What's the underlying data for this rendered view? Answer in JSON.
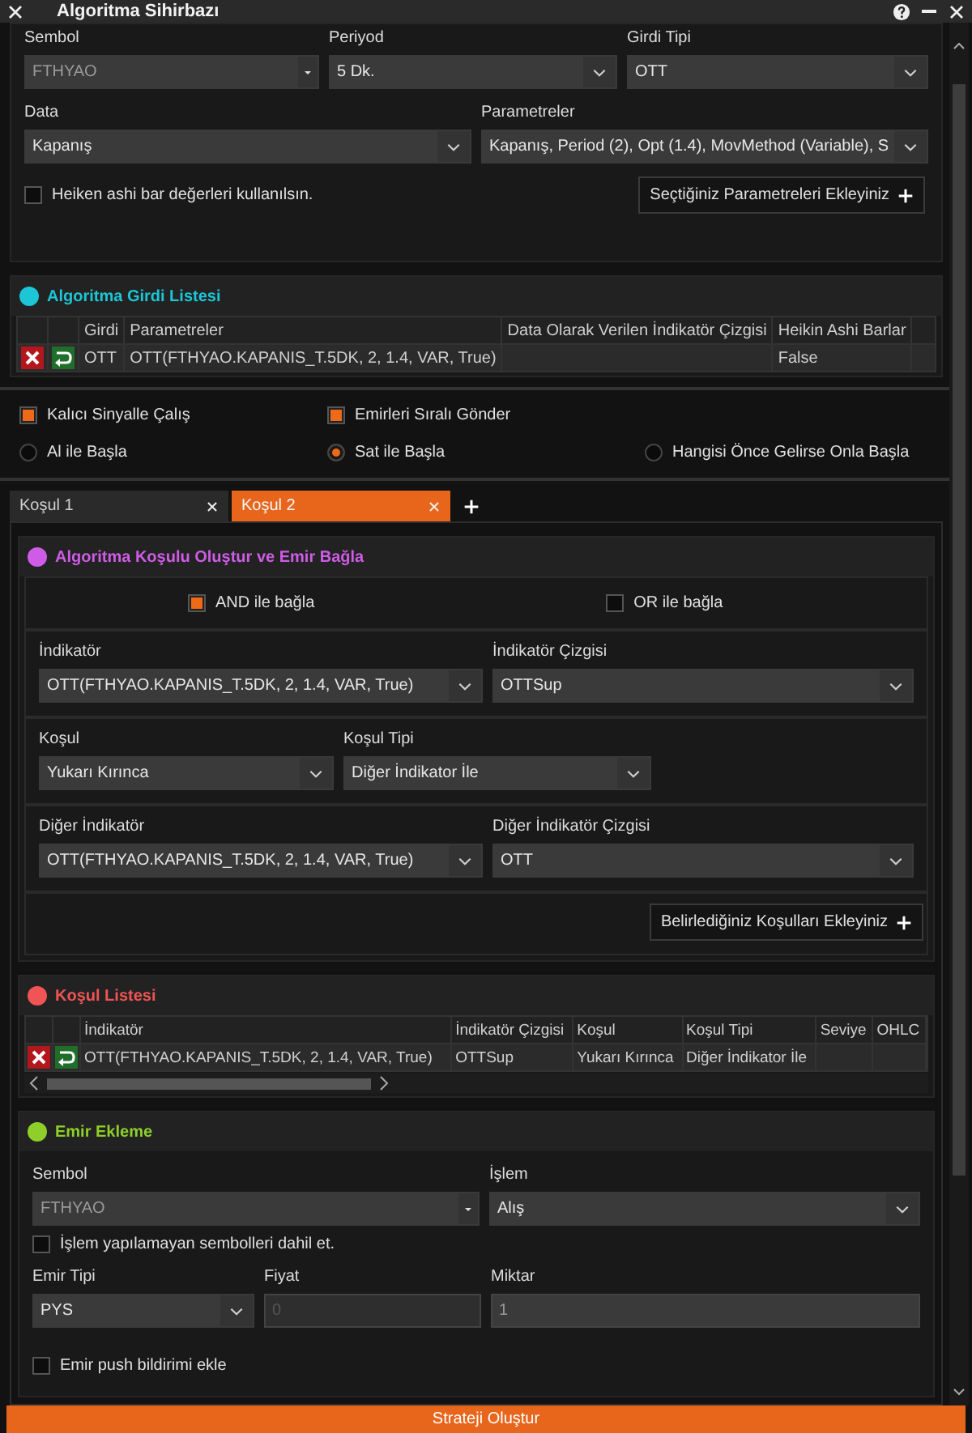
{
  "window": {
    "title": "Algoritma Sihirbazı"
  },
  "input_form": {
    "rows": [
      {
        "fields": [
          {
            "label": "Sembol",
            "value": "FTHYAO",
            "kind": "symbol"
          },
          {
            "label": "Periyod",
            "value": "5 Dk.",
            "kind": "select"
          },
          {
            "label": "Girdi Tipi",
            "value": "OTT",
            "kind": "select"
          }
        ]
      },
      {
        "fields": [
          {
            "label": "Data",
            "value": "Kapanış",
            "kind": "select"
          },
          {
            "label": "Parametreler",
            "value": "Kapanış, Period (2), Opt (1.4), MovMethod (Variable), S",
            "kind": "select"
          }
        ]
      }
    ],
    "heiken_checkbox": {
      "label": "Heiken ashi bar değerleri kullanılsın.",
      "checked": false
    },
    "add_button": "Seçtiğiniz Parametreleri Ekleyiniz"
  },
  "input_list": {
    "title": "Algoritma Girdi Listesi",
    "color": "#1cc6d6",
    "columns": [
      "Girdi",
      "Parametreler",
      "Data Olarak Verilen İndikatör Çizgisi",
      "Heikin Ashi Barlar"
    ],
    "rows": [
      [
        "OTT",
        "OTT(FTHYAO.KAPANIS_T.5DK, 2, 1.4, VAR, True)",
        null,
        "False"
      ]
    ]
  },
  "options": {
    "checkboxes": [
      {
        "label": "Kalıcı Sinyalle Çalış",
        "checked": true
      },
      {
        "label": "Emirleri Sıralı Gönder",
        "checked": true
      }
    ],
    "radios": [
      {
        "label": "Al ile Başla",
        "selected": false
      },
      {
        "label": "Sat ile Başla",
        "selected": true
      },
      {
        "label": "Hangisi Önce Gelirse Onla Başla",
        "selected": false
      }
    ]
  },
  "tabs": [
    {
      "label": "Koşul 1",
      "selected": false
    },
    {
      "label": "Koşul 2",
      "selected": true
    }
  ],
  "condition": {
    "title": "Algoritma Koşulu Oluştur ve Emir Bağla",
    "color": "#cf5ce6",
    "connectors": [
      {
        "label": "AND ile bağla",
        "checked": true
      },
      {
        "label": "OR ile bağla",
        "checked": false
      }
    ],
    "rows": [
      {
        "fields": [
          {
            "label": "İndikatör",
            "value": "OTT(FTHYAO.KAPANIS_T.5DK, 2, 1.4, VAR, True)",
            "kind": "select"
          },
          {
            "label": "İndikatör Çizgisi",
            "value": "OTTSup",
            "kind": "select"
          }
        ]
      },
      {
        "fields": [
          {
            "label": "Koşul",
            "value": "Yukarı Kırınca",
            "kind": "select"
          },
          {
            "label": "Koşul Tipi",
            "value": "Diğer İndikator İle",
            "kind": "select"
          }
        ]
      },
      {
        "fields": [
          {
            "label": "Diğer İndikatör",
            "value": "OTT(FTHYAO.KAPANIS_T.5DK, 2, 1.4, VAR, True)",
            "kind": "select"
          },
          {
            "label": "Diğer İndikatör Çizgisi",
            "value": "OTT",
            "kind": "select"
          }
        ]
      }
    ],
    "add_button": "Belirlediğiniz Koşulları Ekleyiniz"
  },
  "condition_list": {
    "title": "Koşul Listesi",
    "color": "#f05454",
    "columns": [
      "İndikatör",
      "İndikatör Çizgisi",
      "Koşul",
      "Koşul Tipi",
      "Seviye",
      "OHLC"
    ],
    "rows": [
      [
        "OTT(FTHYAO.KAPANIS_T.5DK, 2, 1.4, VAR, True)",
        "OTTSup",
        "Yukarı Kırınca",
        "Diğer İndikator İle"
      ]
    ]
  },
  "order": {
    "title": "Emir Ekleme",
    "color": "#8ecf2a",
    "rows": [
      {
        "fields": [
          {
            "label": "Sembol",
            "value": "FTHYAO",
            "kind": "symbol",
            "disabled": false
          },
          {
            "label": "İşlem",
            "value": "Alış",
            "kind": "select",
            "disabled": false
          }
        ]
      }
    ],
    "untradable_checkbox": {
      "label": "İşlem yapılamayan sembolleri dahil et.",
      "checked": false
    },
    "rows2": [
      {
        "fields": [
          {
            "label": "Emir Tipi",
            "value": "PYS",
            "kind": "select",
            "disabled": false
          },
          {
            "label": "Fiyat",
            "value": "0",
            "kind": "text",
            "disabled": true
          },
          {
            "label": "Miktar",
            "value": "1",
            "kind": "text",
            "disabled": false
          }
        ]
      }
    ],
    "push_checkbox": {
      "label": "Emir push bildirimi ekle",
      "checked": false
    }
  },
  "submit_button": "Strateji Oluştur"
}
